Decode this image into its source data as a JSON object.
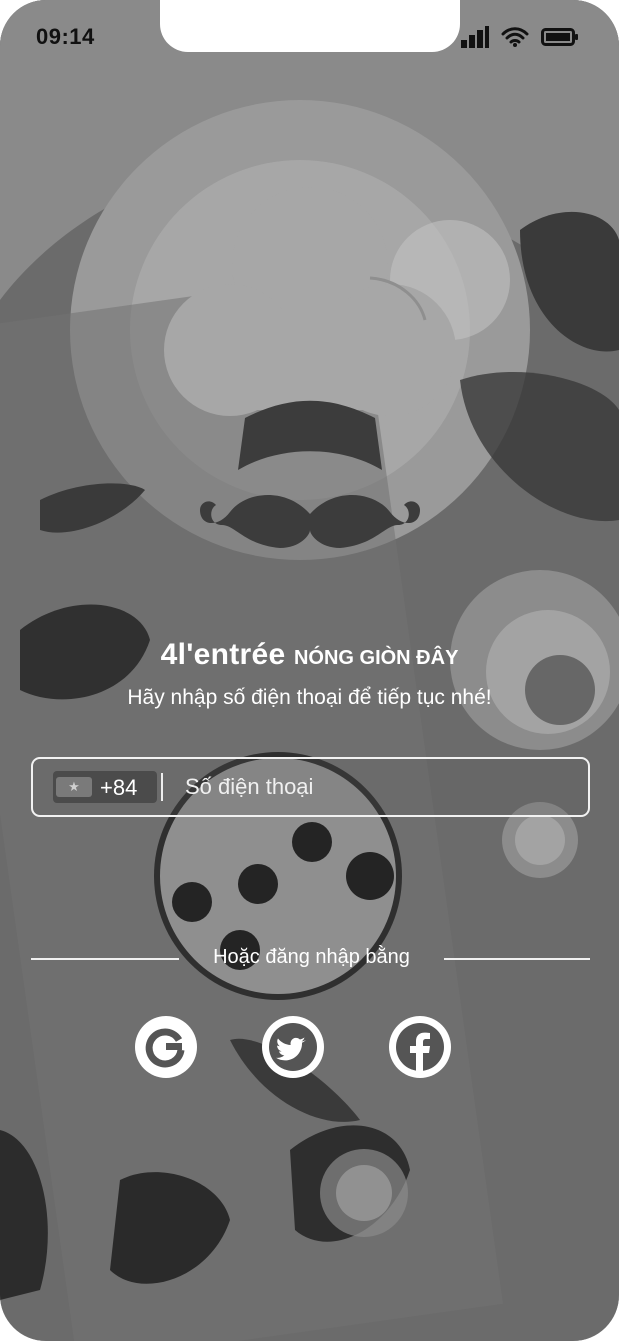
{
  "status_bar": {
    "time": "09:14"
  },
  "brand": {
    "name": "4l'entrée",
    "tagline": "NÓNG GIÒN ĐÂY"
  },
  "subtitle": "Hãy nhập số điện thoại để tiếp tục nhé!",
  "phone_field": {
    "country_code": "+84",
    "placeholder": "Số điện thoại",
    "value": ""
  },
  "divider": {
    "label": "Hoặc đăng nhập bằng"
  },
  "social_login": [
    {
      "provider": "google",
      "icon": "google-icon"
    },
    {
      "provider": "twitter",
      "icon": "twitter-icon"
    },
    {
      "provider": "facebook",
      "icon": "facebook-icon"
    }
  ],
  "colors": {
    "overlay": "#6f6f6f",
    "text": "#ffffff",
    "logo_light": "#a7a7a7",
    "logo_dark": "#3c3c3c"
  }
}
